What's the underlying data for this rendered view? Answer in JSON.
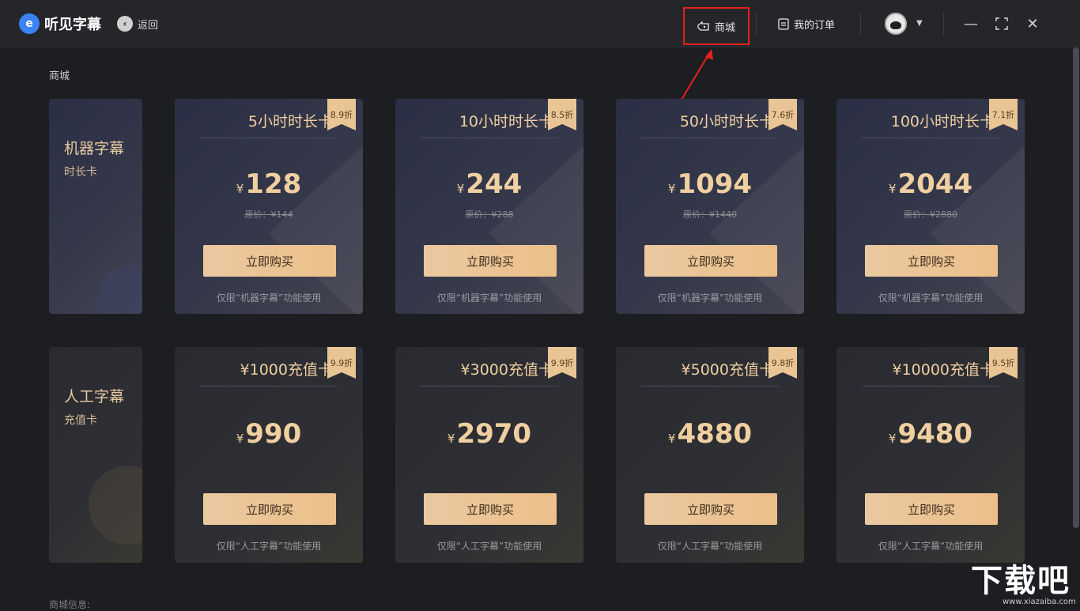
{
  "app": {
    "name": "听见字幕",
    "back_label": "返回"
  },
  "nav": {
    "shop_label": "商城",
    "orders_label": "我的订单"
  },
  "section_title": "商城",
  "footer_label": "商城信息:",
  "watermark": {
    "text": "下载吧",
    "url": "www.xiazaiba.com"
  },
  "categories": [
    {
      "title": "机器字幕",
      "subtitle": "时长卡"
    },
    {
      "title": "人工字幕",
      "subtitle": "充值卡"
    }
  ],
  "row1": [
    {
      "title": "5小时时长卡",
      "discount": "8.9折",
      "currency": "¥",
      "price": "128",
      "original": "原价：¥144",
      "buy": "立即购买",
      "note": "仅限“机器字幕”功能使用"
    },
    {
      "title": "10小时时长卡",
      "discount": "8.5折",
      "currency": "¥",
      "price": "244",
      "original": "原价：¥288",
      "buy": "立即购买",
      "note": "仅限“机器字幕”功能使用"
    },
    {
      "title": "50小时时长卡",
      "discount": "7.6折",
      "currency": "¥",
      "price": "1094",
      "original": "原价：¥1440",
      "buy": "立即购买",
      "note": "仅限“机器字幕”功能使用"
    },
    {
      "title": "100小时时长卡",
      "discount": "7.1折",
      "currency": "¥",
      "price": "2044",
      "original": "原价：¥2880",
      "buy": "立即购买",
      "note": "仅限“机器字幕”功能使用"
    }
  ],
  "row2": [
    {
      "title": "¥1000充值卡",
      "discount": "9.9折",
      "currency": "¥",
      "price": "990",
      "buy": "立即购买",
      "note": "仅限“人工字幕”功能使用"
    },
    {
      "title": "¥3000充值卡",
      "discount": "9.9折",
      "currency": "¥",
      "price": "2970",
      "buy": "立即购买",
      "note": "仅限“人工字幕”功能使用"
    },
    {
      "title": "¥5000充值卡",
      "discount": "9.8折",
      "currency": "¥",
      "price": "4880",
      "buy": "立即购买",
      "note": "仅限“人工字幕”功能使用"
    },
    {
      "title": "¥10000充值卡",
      "discount": "9.5折",
      "currency": "¥",
      "price": "9480",
      "buy": "立即购买",
      "note": "仅限“人工字幕”功能使用"
    }
  ],
  "colors": {
    "accent": "#ecc08a",
    "highlight_box": "#e8201c",
    "background": "#1d1e22"
  }
}
